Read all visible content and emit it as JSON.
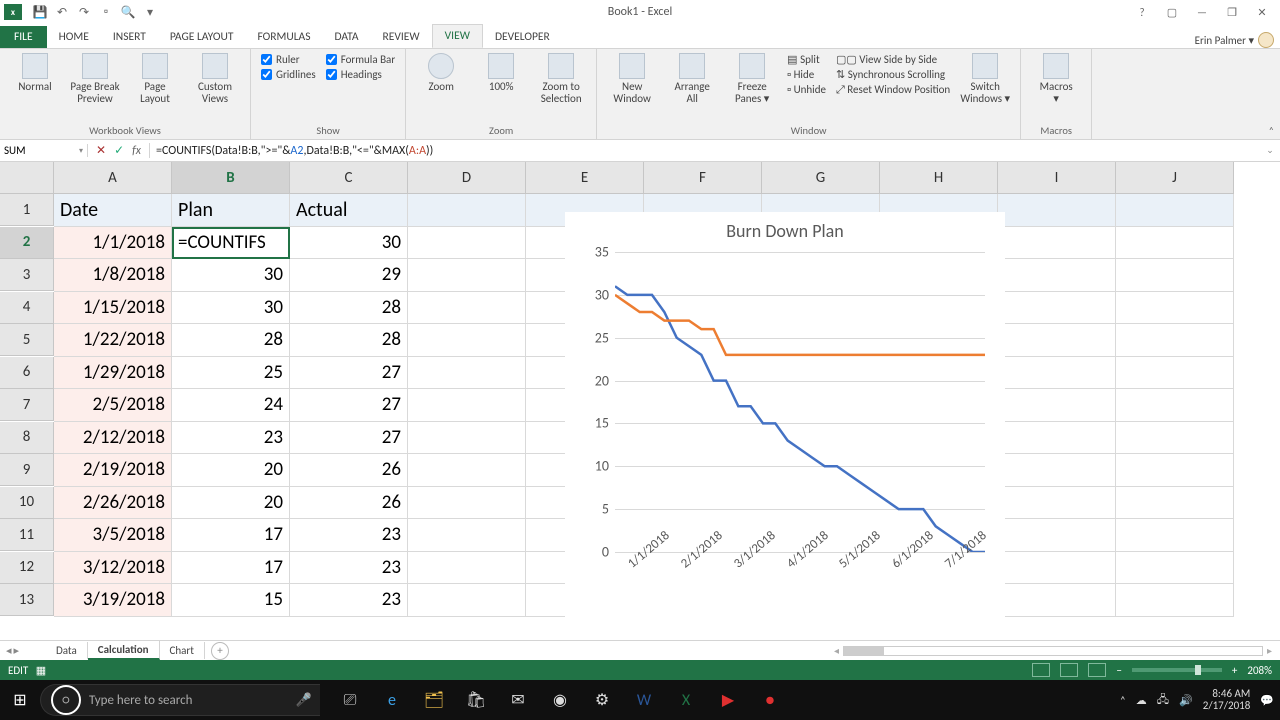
{
  "titlebar": {
    "app": "x",
    "doc_title": "Book1 - Excel",
    "qat_icons": [
      "save",
      "undo",
      "redo",
      "new",
      "touch",
      "▾"
    ]
  },
  "window_controls": {
    "help": "?",
    "ribbon_opts": "▢",
    "min": "—",
    "restore": "❐",
    "close": "✕"
  },
  "tabs": {
    "file": "FILE",
    "items": [
      "HOME",
      "INSERT",
      "PAGE LAYOUT",
      "FORMULAS",
      "DATA",
      "REVIEW",
      "VIEW",
      "DEVELOPER"
    ],
    "active": "VIEW",
    "user": "Erin Palmer ▾"
  },
  "ribbon": {
    "groups": [
      {
        "name": "Workbook Views",
        "bigs": [
          "Normal",
          "Page Break\nPreview",
          "Page\nLayout",
          "Custom\nViews"
        ]
      },
      {
        "name": "Show",
        "checks": [
          [
            "Ruler",
            true
          ],
          [
            "Formula Bar",
            true
          ],
          [
            "Gridlines",
            true
          ],
          [
            "Headings",
            true
          ]
        ]
      },
      {
        "name": "Zoom",
        "bigs": [
          "Zoom",
          "100%",
          "Zoom to\nSelection"
        ]
      },
      {
        "name": "Window",
        "bigs": [
          "New\nWindow",
          "Arrange\nAll",
          "Freeze\nPanes ▾"
        ],
        "lines": [
          "Split",
          "Hide",
          "Unhide"
        ],
        "lines2": [
          "View Side by Side",
          "Synchronous Scrolling",
          "Reset Window Position"
        ],
        "bigs2": [
          "Switch\nWindows ▾"
        ]
      },
      {
        "name": "Macros",
        "bigs": [
          "Macros\n▾"
        ]
      }
    ]
  },
  "formula": {
    "name_box": "SUM",
    "text_prefix": "=COUNTIFS(Data!B:B,\">=\"&",
    "ref1": "A2",
    "text_mid": ",Data!B:B,\"<=\"&MAX(",
    "ref2": "A:A",
    "text_suffix": "))"
  },
  "columns": [
    "A",
    "B",
    "C",
    "D",
    "E",
    "F",
    "G",
    "H",
    "I",
    "J"
  ],
  "headers": {
    "A": "Date",
    "B": "Plan",
    "C": "Actual"
  },
  "active_cell_display": "=COUNTIFS",
  "rows": [
    {
      "n": 1
    },
    {
      "n": 2,
      "A": "1/1/2018",
      "B": "",
      "C": "30"
    },
    {
      "n": 3,
      "A": "1/8/2018",
      "B": "30",
      "C": "29"
    },
    {
      "n": 4,
      "A": "1/15/2018",
      "B": "30",
      "C": "28"
    },
    {
      "n": 5,
      "A": "1/22/2018",
      "B": "28",
      "C": "28"
    },
    {
      "n": 6,
      "A": "1/29/2018",
      "B": "25",
      "C": "27"
    },
    {
      "n": 7,
      "A": "2/5/2018",
      "B": "24",
      "C": "27"
    },
    {
      "n": 8,
      "A": "2/12/2018",
      "B": "23",
      "C": "27"
    },
    {
      "n": 9,
      "A": "2/19/2018",
      "B": "20",
      "C": "26"
    },
    {
      "n": 10,
      "A": "2/26/2018",
      "B": "20",
      "C": "26"
    },
    {
      "n": 11,
      "A": "3/5/2018",
      "B": "17",
      "C": "23"
    },
    {
      "n": 12,
      "A": "3/12/2018",
      "B": "17",
      "C": "23"
    },
    {
      "n": 13,
      "A": "3/19/2018",
      "B": "15",
      "C": "23"
    }
  ],
  "chart_data": {
    "type": "line",
    "title": "Burn Down Plan",
    "ylabel": "",
    "xlabel": "",
    "ylim": [
      0,
      35
    ],
    "yticks": [
      0,
      5,
      10,
      15,
      20,
      25,
      30,
      35
    ],
    "xticks": [
      "1/1/2018",
      "2/1/2018",
      "3/1/2018",
      "4/1/2018",
      "5/1/2018",
      "6/1/2018",
      "7/1/2018"
    ],
    "series": [
      {
        "name": "Plan",
        "color": "#4472c4",
        "values": [
          31,
          30,
          30,
          30,
          28,
          25,
          24,
          23,
          20,
          20,
          17,
          17,
          15,
          15,
          13,
          12,
          11,
          10,
          10,
          9,
          8,
          7,
          6,
          5,
          5,
          5,
          3,
          2,
          1,
          0,
          0
        ]
      },
      {
        "name": "Actual",
        "color": "#ed7d31",
        "values": [
          30,
          29,
          28,
          28,
          27,
          27,
          27,
          26,
          26,
          23,
          23,
          23,
          23,
          23,
          23,
          23,
          23,
          23,
          23,
          23,
          23,
          23,
          23,
          23,
          23,
          23,
          23,
          23,
          23,
          23,
          23
        ]
      }
    ]
  },
  "sheet_tabs": {
    "items": [
      "Data",
      "Calculation",
      "Chart"
    ],
    "active": "Calculation"
  },
  "statusbar": {
    "mode": "EDIT",
    "zoom": "208%"
  },
  "taskbar": {
    "search_placeholder": "Type here to search",
    "apps": [
      "task-view",
      "edge",
      "file-explorer",
      "store",
      "mail",
      "chrome",
      "settings",
      "word",
      "excel",
      "video",
      "snip"
    ],
    "tray": {
      "time": "8:46 AM",
      "date": "2/17/2018"
    }
  }
}
